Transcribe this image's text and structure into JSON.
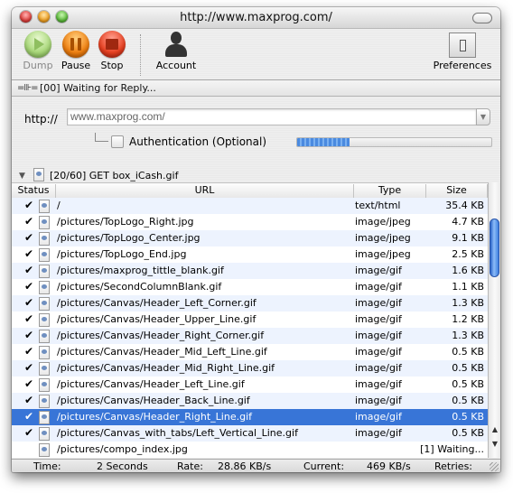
{
  "window": {
    "title": "http://www.maxprog.com/"
  },
  "toolbar": {
    "dump_label": "Dump",
    "pause_label": "Pause",
    "stop_label": "Stop",
    "account_label": "Account",
    "preferences_label": "Preferences"
  },
  "status": {
    "text": "[00] Waiting for Reply..."
  },
  "form": {
    "http_label": "http://",
    "url_value": "www.maxprog.com/",
    "auth_label": "Authentication (Optional)",
    "auth_checked": false,
    "progress_fraction": 0.27
  },
  "request": {
    "label": "[20/60]  GET box_iCash.gif"
  },
  "table": {
    "columns": [
      "Status",
      "URL",
      "Type",
      "Size"
    ],
    "rows": [
      {
        "status": "done",
        "url": "/",
        "type": "text/html",
        "size": "35.4 KB"
      },
      {
        "status": "done",
        "url": "/pictures/TopLogo_Right.jpg",
        "type": "image/jpeg",
        "size": "4.7 KB"
      },
      {
        "status": "done",
        "url": "/pictures/TopLogo_Center.jpg",
        "type": "image/jpeg",
        "size": "9.1 KB"
      },
      {
        "status": "done",
        "url": "/pictures/TopLogo_End.jpg",
        "type": "image/jpeg",
        "size": "2.5 KB"
      },
      {
        "status": "done",
        "url": "/pictures/maxprog_tittle_blank.gif",
        "type": "image/gif",
        "size": "1.6 KB"
      },
      {
        "status": "done",
        "url": "/pictures/SecondColumnBlank.gif",
        "type": "image/gif",
        "size": "1.1 KB"
      },
      {
        "status": "done",
        "url": "/pictures/Canvas/Header_Left_Corner.gif",
        "type": "image/gif",
        "size": "1.3 KB"
      },
      {
        "status": "done",
        "url": "/pictures/Canvas/Header_Upper_Line.gif",
        "type": "image/gif",
        "size": "1.2 KB"
      },
      {
        "status": "done",
        "url": "/pictures/Canvas/Header_Right_Corner.gif",
        "type": "image/gif",
        "size": "1.3 KB"
      },
      {
        "status": "done",
        "url": "/pictures/Canvas/Header_Mid_Left_Line.gif",
        "type": "image/gif",
        "size": "0.5 KB"
      },
      {
        "status": "done",
        "url": "/pictures/Canvas/Header_Mid_Right_Line.gif",
        "type": "image/gif",
        "size": "0.5 KB"
      },
      {
        "status": "done",
        "url": "/pictures/Canvas/Header_Left_Line.gif",
        "type": "image/gif",
        "size": "0.5 KB"
      },
      {
        "status": "done",
        "url": "/pictures/Canvas/Header_Back_Line.gif",
        "type": "image/gif",
        "size": "0.5 KB"
      },
      {
        "status": "done",
        "url": "/pictures/Canvas/Header_Right_Line.gif",
        "type": "image/gif",
        "size": "0.5 KB",
        "selected": true
      },
      {
        "status": "done",
        "url": "/pictures/Canvas_with_tabs/Left_Vertical_Line.gif",
        "type": "image/gif",
        "size": "0.5 KB"
      },
      {
        "status": "pending",
        "url": "/pictures/compo_index.jpg",
        "type": "",
        "size": "[1] Waiting..."
      }
    ]
  },
  "footer": {
    "time_label": "Time:",
    "time_value": "2 Seconds",
    "rate_label": "Rate:",
    "rate_value": "28.86  KB/s",
    "current_label": "Current:",
    "current_value": "469  KB/s",
    "retries_label": "Retries:"
  },
  "icons": {
    "check": "✔",
    "disclosure": "▼",
    "dropdown": "▼",
    "scroll_up": "▲",
    "scroll_down": "▼",
    "plug": "=⊪="
  }
}
